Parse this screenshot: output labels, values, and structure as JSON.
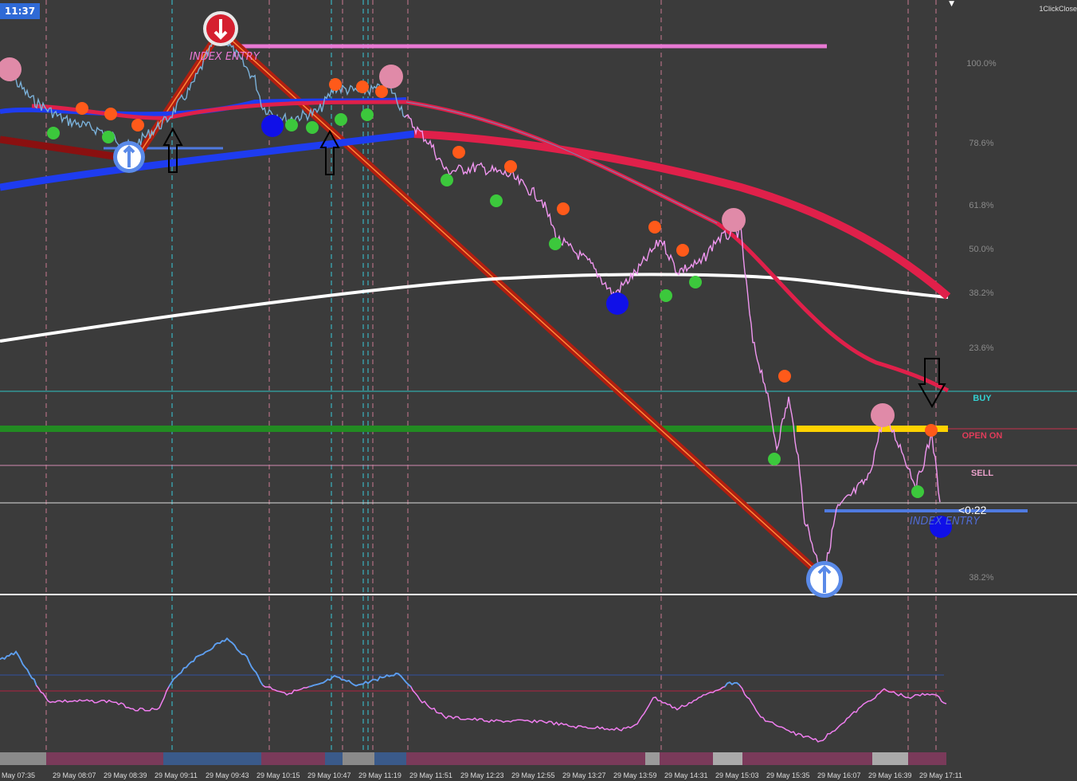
{
  "window": {
    "clock": "11:37",
    "one_click_label": "1ClickClose",
    "countdown": "<0:22",
    "collapse_icon": "triangle-down-icon"
  },
  "fib_levels": [
    {
      "label": "100.0%",
      "color": "#8a8a8a"
    },
    {
      "label": "78.6%",
      "color": "#8a8a8a"
    },
    {
      "label": "61.8%",
      "color": "#8a8a8a"
    },
    {
      "label": "50.0%",
      "color": "#8a8a8a"
    },
    {
      "label": "38.2%",
      "color": "#8a8a8a"
    },
    {
      "label": "23.6%",
      "color": "#8a8a8a"
    },
    {
      "label": "38.2%",
      "color": "#8a8a8a"
    }
  ],
  "trade_lines": [
    {
      "label": "BUY",
      "color": "#33d0d0"
    },
    {
      "label": "OPEN ON",
      "color": "#e03c5a"
    },
    {
      "label": "SELL",
      "color": "#e9a0c9"
    }
  ],
  "annotations": [
    {
      "text": "INDEX ENTRY",
      "color": "#e879d3"
    },
    {
      "text": "INDEX ENTRY",
      "color": "#4f6ad0"
    }
  ],
  "time_axis": [
    "May 07:35",
    "29 May 08:07",
    "29 May 08:39",
    "29 May 09:11",
    "29 May 09:43",
    "29 May 10:15",
    "29 May 10:47",
    "29 May 11:19",
    "29 May 11:51",
    "29 May 12:23",
    "29 May 12:55",
    "29 May 13:27",
    "29 May 13:59",
    "29 May 14:31",
    "29 May 15:03",
    "29 May 15:35",
    "29 May 16:07",
    "29 May 16:39",
    "29 May 17:11"
  ],
  "colors": {
    "background": "#3b3b3b",
    "price": "#f096f0",
    "ma_red": "#e0204a",
    "ma_blue": "#1e3cf0",
    "ma_white": "#ffffff",
    "trend": "#b01e10",
    "green_level": "#228b22",
    "yellow_level": "#ffd200",
    "oscillator_blue": "#5aa0f0",
    "oscillator_pink": "#f07ef0"
  },
  "icons": {
    "sell_signal": "down-arrow-circle-icon",
    "buy_signal": "up-arrow-circle-icon",
    "outline_up": "outline-up-arrow-icon",
    "outline_down": "outline-down-arrow-icon"
  }
}
